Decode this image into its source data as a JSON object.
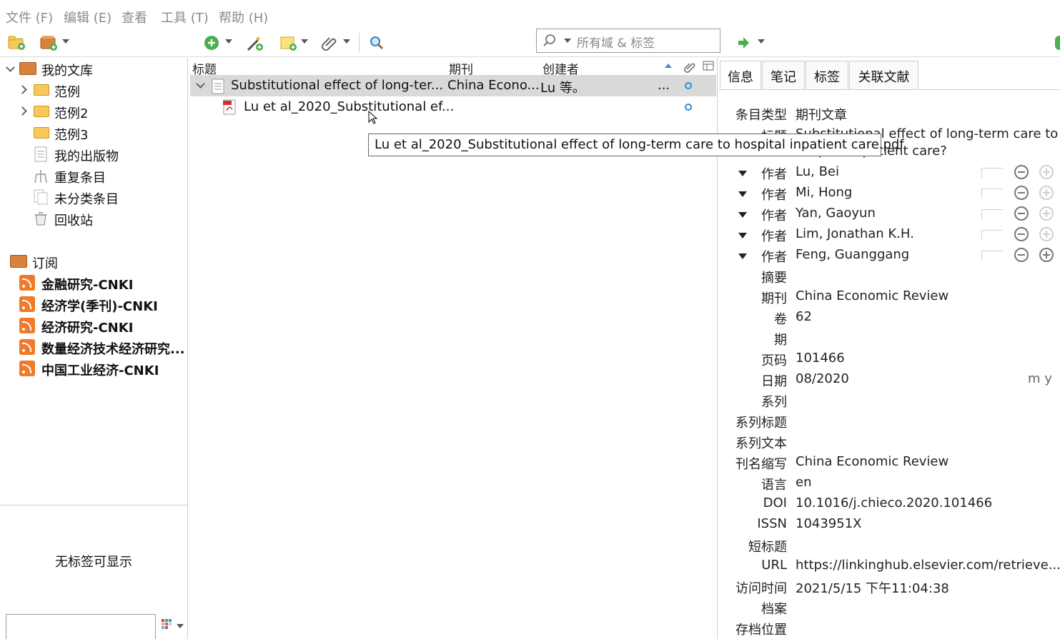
{
  "menubar": {
    "file": "文件 (F)",
    "edit": "编辑 (E)",
    "view": "查看",
    "tools": "工具 (T)",
    "help": "帮助 (H)"
  },
  "toolbar": {
    "search_placeholder": "所有域 & 标签",
    "icons": [
      "new-collection-icon",
      "new-library-icon",
      "new-item-icon",
      "magic-wand-icon",
      "new-note-icon",
      "attachment-icon",
      "advanced-search-icon",
      "search-icon",
      "locate-icon"
    ]
  },
  "library": {
    "root": "我的文库",
    "items": [
      {
        "label": "范例"
      },
      {
        "label": "范例2"
      },
      {
        "label": "范例3"
      },
      {
        "label": "我的出版物"
      },
      {
        "label": "重复条目"
      },
      {
        "label": "未分类条目"
      },
      {
        "label": "回收站"
      }
    ],
    "feeds_title": "订阅",
    "feeds": [
      {
        "label": "金融研究-CNKI"
      },
      {
        "label": "经济学(季刊)-CNKI"
      },
      {
        "label": "经济研究-CNKI"
      },
      {
        "label": "数量经济技术经济研究..."
      },
      {
        "label": "中国工业经济-CNKI"
      }
    ]
  },
  "tag_selector": {
    "empty_text": "无标签可显示"
  },
  "items_list": {
    "columns": {
      "title": "标题",
      "publication": "期刊",
      "creator": "创建者"
    },
    "rows": [
      {
        "title": "Substitutional effect of long-ter...",
        "publication": "China Econo...",
        "creator": "Lu 等。",
        "more": "..."
      },
      {
        "title": "Lu et al_2020_Substitutional ef..."
      }
    ],
    "tooltip": "Lu et al_2020_Substitutional effect of long-term care to hospital inpatient care.pdf"
  },
  "item_pane": {
    "tabs": {
      "info": "信息",
      "notes": "笔记",
      "tags": "标签",
      "related": "关联文献"
    },
    "item_type_label": "条目类型",
    "item_type": "期刊文章",
    "title_label": "标题",
    "title_line1": "Substitutional effect of long-term care to",
    "title_line2": "hospital inpatient care?",
    "creators": [
      {
        "role": "作者",
        "name": "Lu, Bei"
      },
      {
        "role": "作者",
        "name": "Mi, Hong"
      },
      {
        "role": "作者",
        "name": "Yan, Gaoyun"
      },
      {
        "role": "作者",
        "name": "Lim, Jonathan K.H."
      },
      {
        "role": "作者",
        "name": "Feng, Guanggang"
      }
    ],
    "fields": [
      {
        "label": "摘要",
        "value": ""
      },
      {
        "label": "期刊",
        "value": "China Economic Review"
      },
      {
        "label": "卷",
        "value": "62"
      },
      {
        "label": "期",
        "value": ""
      },
      {
        "label": "页码",
        "value": "101466"
      },
      {
        "label": "日期",
        "value": "08/2020"
      },
      {
        "label": "系列",
        "value": ""
      },
      {
        "label": "系列标题",
        "value": ""
      },
      {
        "label": "系列文本",
        "value": ""
      },
      {
        "label": "刊名缩写",
        "value": "China Economic Review"
      },
      {
        "label": "语言",
        "value": "en"
      },
      {
        "label": "DOI",
        "value": "10.1016/j.chieco.2020.101466"
      },
      {
        "label": "ISSN",
        "value": "1043951X"
      },
      {
        "label": "短标题",
        "value": ""
      },
      {
        "label": "URL",
        "value": "https://linkinghub.elsevier.com/retrieve..."
      },
      {
        "label": "访问时间",
        "value": "2021/5/15 下午11:04:38"
      },
      {
        "label": "档案",
        "value": ""
      },
      {
        "label": "存档位置",
        "value": ""
      }
    ],
    "date_format": "m y"
  }
}
